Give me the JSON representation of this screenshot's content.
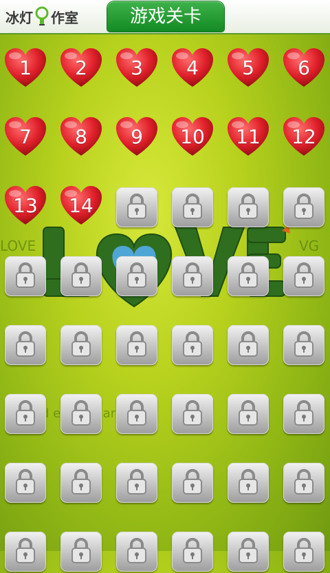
{
  "header": {
    "brand_part1": "冰灯",
    "brand_part2": "作室",
    "title": "游戏关卡"
  },
  "background": {
    "word": "LOVE",
    "side_left": "LOVE",
    "side_right": "VG",
    "bottom_text": "d   e   ea   n   i   ar   o"
  },
  "levels": {
    "unlocked": [
      "1",
      "2",
      "3",
      "4",
      "5",
      "6",
      "7",
      "8",
      "9",
      "10",
      "11",
      "12",
      "13",
      "14"
    ],
    "locked_count_visible": 34
  },
  "colors": {
    "heart": "#e0202a",
    "title_tab": "#1f9a30",
    "lock_tile": "#c8c8c8"
  }
}
